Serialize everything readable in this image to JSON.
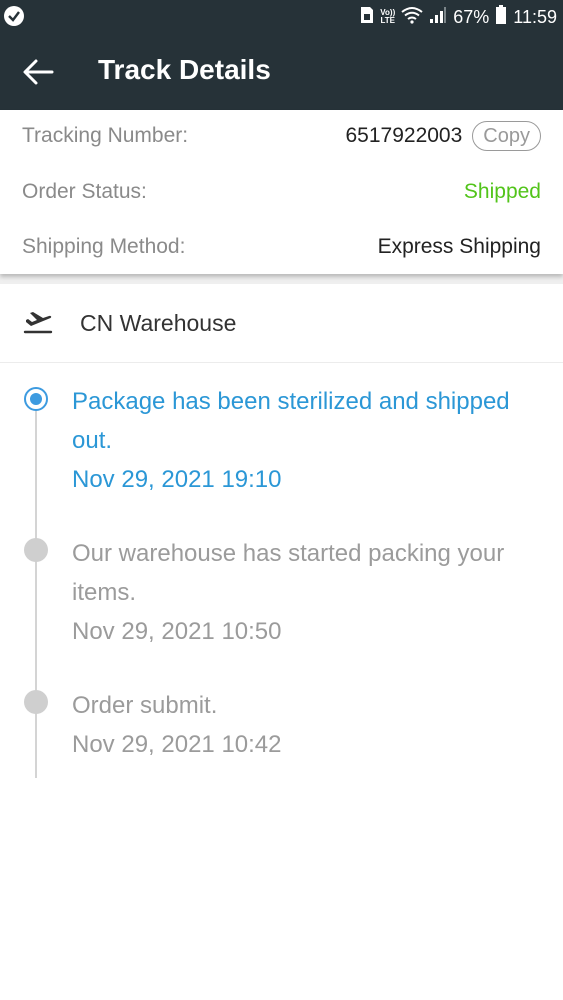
{
  "status_bar": {
    "volte_top": "Vo))",
    "volte_bottom": "LTE",
    "battery": "67%",
    "time": "11:59"
  },
  "header": {
    "title": "Track Details"
  },
  "summary": {
    "tracking_label": "Tracking Number:",
    "tracking_number": "6517922003",
    "copy_label": "Copy",
    "status_label": "Order Status:",
    "status_value": "Shipped",
    "method_label": "Shipping Method:",
    "method_value": "Express Shipping"
  },
  "warehouse": {
    "name": "CN Warehouse",
    "icon": "airplane-departure-icon"
  },
  "events": [
    {
      "text": "Package has been sterilized and shipped out.",
      "time": "Nov 29, 2021 19:10",
      "active": true
    },
    {
      "text": "Our warehouse has started packing your items.",
      "time": "Nov 29, 2021 10:50",
      "active": false
    },
    {
      "text": "Order submit.",
      "time": "Nov 29, 2021 10:42",
      "active": false
    }
  ],
  "colors": {
    "header_bg": "#263238",
    "active_blue": "#2b97d6",
    "shipped_green": "#52c41a",
    "inactive_gray": "#9b9b9b"
  }
}
